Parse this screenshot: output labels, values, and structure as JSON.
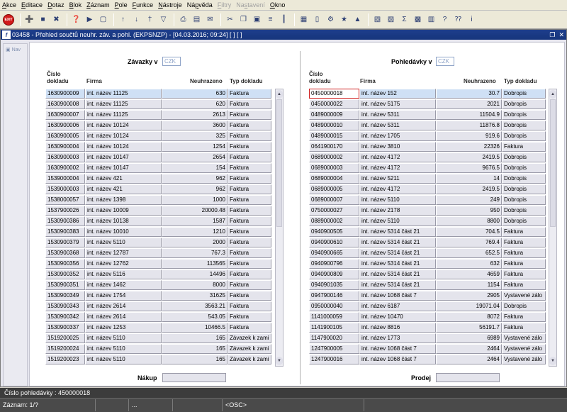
{
  "menu": [
    {
      "pre": "",
      "u": "A",
      "post": "kce",
      "disabled": false
    },
    {
      "pre": "",
      "u": "E",
      "post": "ditace",
      "disabled": false
    },
    {
      "pre": "",
      "u": "D",
      "post": "otaz",
      "disabled": false
    },
    {
      "pre": "",
      "u": "B",
      "post": "lok",
      "disabled": false
    },
    {
      "pre": "",
      "u": "Z",
      "post": "áznam",
      "disabled": false
    },
    {
      "pre": "",
      "u": "P",
      "post": "ole",
      "disabled": false
    },
    {
      "pre": "",
      "u": "F",
      "post": "unkce",
      "disabled": false
    },
    {
      "pre": "",
      "u": "N",
      "post": "ástroje",
      "disabled": false
    },
    {
      "pre": "Ná",
      "u": "p",
      "post": "věda",
      "disabled": false
    },
    {
      "pre": "",
      "u": "F",
      "post": "iltry",
      "disabled": true
    },
    {
      "pre": "Na",
      "u": "s",
      "post": "tavení",
      "disabled": true
    },
    {
      "pre": "",
      "u": "O",
      "post": "kno",
      "disabled": false
    }
  ],
  "toolbar": {
    "exit_label": "EXIT",
    "icons": [
      "new-record-icon",
      "save-icon",
      "delete-record-icon",
      "sep",
      "query-icon",
      "execute-query-icon",
      "cancel-query-icon",
      "sep",
      "sort-asc-icon",
      "sort-desc-icon",
      "pin-icon",
      "filter-icon",
      "sep",
      "print-icon",
      "print-preview-icon",
      "mail-icon",
      "sep",
      "cut-icon",
      "copy-icon",
      "paste-icon",
      "insert-row-icon",
      "columns-icon",
      "sep",
      "calculator-icon",
      "document-icon",
      "settings-icon",
      "star-icon",
      "triangle-icon",
      "sep",
      "report-icon",
      "report2-icon",
      "sum-icon",
      "excel-icon",
      "sheet-icon",
      "help-icon",
      "whats-this-icon",
      "info-icon"
    ]
  },
  "window": {
    "title": "03458 - Přehled součtů neuhr. záv. a pohl. (EKPSNZP) - [04.03.2016; 09:24]  [ ]  [ ]",
    "nav_label": "Nav"
  },
  "left": {
    "label": "Závazky v",
    "currency": "CZK",
    "headers": {
      "doc_line1": "Číslo",
      "doc_line2": "dokladu",
      "firm": "Firma",
      "amount": "Neuhrazeno",
      "type": "Typ dokladu"
    },
    "rows": [
      {
        "doc": "1630900009",
        "firm": "int. název 11125",
        "amount": "630",
        "type": "Faktura"
      },
      {
        "doc": "1630900008",
        "firm": "int. název 11125",
        "amount": "620",
        "type": "Faktura"
      },
      {
        "doc": "1630900007",
        "firm": "int. název 11125",
        "amount": "2613",
        "type": "Faktura"
      },
      {
        "doc": "1630900006",
        "firm": "int. název 10124",
        "amount": "3600",
        "type": "Faktura"
      },
      {
        "doc": "1630900005",
        "firm": "int. název 10124",
        "amount": "325",
        "type": "Faktura"
      },
      {
        "doc": "1630900004",
        "firm": "int. název 10124",
        "amount": "1254",
        "type": "Faktura"
      },
      {
        "doc": "1630900003",
        "firm": "int. název 10147",
        "amount": "2654",
        "type": "Faktura"
      },
      {
        "doc": "1630900002",
        "firm": "int. název 10147",
        "amount": "154",
        "type": "Faktura"
      },
      {
        "doc": "1539000004",
        "firm": "int. název 421",
        "amount": "962",
        "type": "Faktura"
      },
      {
        "doc": "1539000003",
        "firm": "int. název 421",
        "amount": "962",
        "type": "Faktura"
      },
      {
        "doc": "1538000057",
        "firm": "int. název 1398",
        "amount": "1000",
        "type": "Faktura"
      },
      {
        "doc": "1537900026",
        "firm": "int. název 10009",
        "amount": "20000.48",
        "type": "Faktura"
      },
      {
        "doc": "1530900386",
        "firm": "int. název 10138",
        "amount": "1587",
        "type": "Faktura"
      },
      {
        "doc": "1530900383",
        "firm": "int. název 10010",
        "amount": "1210",
        "type": "Faktura"
      },
      {
        "doc": "1530900379",
        "firm": "int. název 5110",
        "amount": "2000",
        "type": "Faktura"
      },
      {
        "doc": "1530900368",
        "firm": "int. název 12787",
        "amount": "767.3",
        "type": "Faktura"
      },
      {
        "doc": "1530900356",
        "firm": "int. název 12762",
        "amount": "113565",
        "type": "Faktura"
      },
      {
        "doc": "1530900352",
        "firm": "int. název 5116",
        "amount": "14496",
        "type": "Faktura"
      },
      {
        "doc": "1530900351",
        "firm": "int. název 1462",
        "amount": "8000",
        "type": "Faktura"
      },
      {
        "doc": "1530900349",
        "firm": "int. název 1754",
        "amount": "31625",
        "type": "Faktura"
      },
      {
        "doc": "1530900343",
        "firm": "int. název 2614",
        "amount": "3563.21",
        "type": "Faktura"
      },
      {
        "doc": "1530900342",
        "firm": "int. název 2614",
        "amount": "543.05",
        "type": "Faktura"
      },
      {
        "doc": "1530900337",
        "firm": "int. název 1253",
        "amount": "10466.5",
        "type": "Faktura"
      },
      {
        "doc": "1519200025",
        "firm": "int. název 5110",
        "amount": "165",
        "type": "Závazek k zami"
      },
      {
        "doc": "1519200024",
        "firm": "int. název 5110",
        "amount": "165",
        "type": "Závazek k zami"
      },
      {
        "doc": "1519200023",
        "firm": "int. název 5110",
        "amount": "165",
        "type": "Závazek k zami"
      }
    ],
    "footer_label": "Nákup"
  },
  "right": {
    "label": "Pohledávky v",
    "currency": "CZK",
    "headers": {
      "doc_line1": "Číslo",
      "doc_line2": "dokladu",
      "firm": "Firma",
      "amount": "Neuhrazeno",
      "type": "Typ dokladu"
    },
    "rows": [
      {
        "doc": "0450000018",
        "firm": "int. název 152",
        "amount": "30.7",
        "type": "Dobropis"
      },
      {
        "doc": "0450000022",
        "firm": "int. název 5175",
        "amount": "2021",
        "type": "Dobropis"
      },
      {
        "doc": "0489000009",
        "firm": "int. název 5311",
        "amount": "11504.9",
        "type": "Dobropis"
      },
      {
        "doc": "0489000010",
        "firm": "int. název 5311",
        "amount": "11876.8",
        "type": "Dobropis"
      },
      {
        "doc": "0489000015",
        "firm": "int. název 1705",
        "amount": "919.6",
        "type": "Dobropis"
      },
      {
        "doc": "0641900170",
        "firm": "int. název 3810",
        "amount": "22326",
        "type": "Faktura"
      },
      {
        "doc": "0689000002",
        "firm": "int. název 4172",
        "amount": "2419.5",
        "type": "Dobropis"
      },
      {
        "doc": "0689000003",
        "firm": "int. název 4172",
        "amount": "9676.5",
        "type": "Dobropis"
      },
      {
        "doc": "0689000004",
        "firm": "int. název 5211",
        "amount": "14",
        "type": "Dobropis"
      },
      {
        "doc": "0689000005",
        "firm": "int. název 4172",
        "amount": "2419.5",
        "type": "Dobropis"
      },
      {
        "doc": "0689000007",
        "firm": "int. název 5110",
        "amount": "249",
        "type": "Dobropis"
      },
      {
        "doc": "0750000027",
        "firm": "int. název 2178",
        "amount": "950",
        "type": "Dobropis"
      },
      {
        "doc": "0889000002",
        "firm": "int. název 5110",
        "amount": "8800",
        "type": "Dobropis"
      },
      {
        "doc": "0940900505",
        "firm": "int. název 5314 část 21",
        "amount": "704.5",
        "type": "Faktura"
      },
      {
        "doc": "0940900610",
        "firm": "int. název 5314 část 21",
        "amount": "769.4",
        "type": "Faktura"
      },
      {
        "doc": "0940900665",
        "firm": "int. název 5314 část 21",
        "amount": "652.5",
        "type": "Faktura"
      },
      {
        "doc": "0940900796",
        "firm": "int. název 5314 část 21",
        "amount": "632",
        "type": "Faktura"
      },
      {
        "doc": "0940900809",
        "firm": "int. název 5314 část 21",
        "amount": "4659",
        "type": "Faktura"
      },
      {
        "doc": "0940901035",
        "firm": "int. název 5314 část 21",
        "amount": "1154",
        "type": "Faktura"
      },
      {
        "doc": "0947900146",
        "firm": "int. název 1068 část 7",
        "amount": "2905",
        "type": "Vystavené zálo"
      },
      {
        "doc": "0950000040",
        "firm": "int. název 6187",
        "amount": "19071.04",
        "type": "Dobropis"
      },
      {
        "doc": "1141000059",
        "firm": "int. název 10470",
        "amount": "8072",
        "type": "Faktura"
      },
      {
        "doc": "1141900105",
        "firm": "int. název 8816",
        "amount": "56191.7",
        "type": "Faktura"
      },
      {
        "doc": "1147900020",
        "firm": "int. název 1773",
        "amount": "6989",
        "type": "Vystavené zálo"
      },
      {
        "doc": "1247900005",
        "firm": "int. název 1068 část 7",
        "amount": "2464",
        "type": "Vystavené zálo"
      },
      {
        "doc": "1247900016",
        "firm": "int. název 1068 část 7",
        "amount": "2464",
        "type": "Vystavené zálo"
      }
    ],
    "footer_label": "Prodej"
  },
  "status": {
    "message": "Číslo pohledávky : 450000018",
    "record": "Záznam: 1/?",
    "seg2": "",
    "seg3": "...",
    "seg4": "",
    "osc": "<OSC>"
  }
}
